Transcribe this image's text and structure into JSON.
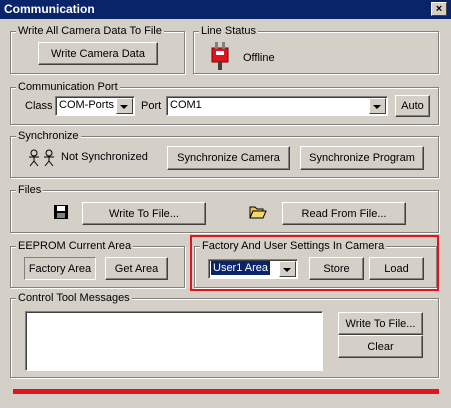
{
  "window": {
    "title": "Communication",
    "close_glyph": "×"
  },
  "write_all": {
    "legend": "Write All Camera Data To File",
    "button": "Write Camera Data"
  },
  "line_status": {
    "legend": "Line Status",
    "status": "Offline",
    "icon": "plug-icon"
  },
  "comm_port": {
    "legend": "Communication Port",
    "class_label": "Class",
    "class_value": "COM-Ports",
    "port_label": "Port",
    "port_value": "COM1",
    "auto_button": "Auto"
  },
  "synchronize": {
    "legend": "Synchronize",
    "status": "Not Synchronized",
    "sync_camera_button": "Synchronize Camera",
    "sync_program_button": "Synchronize Program"
  },
  "files": {
    "legend": "Files",
    "write_button": "Write To File...",
    "read_button": "Read From File..."
  },
  "eeprom": {
    "legend": "EEPROM Current Area",
    "value": "Factory Area",
    "get_button": "Get Area"
  },
  "factory_user": {
    "legend": "Factory And User Settings In Camera",
    "selected": "User1 Area",
    "store_button": "Store",
    "load_button": "Load"
  },
  "messages": {
    "legend": "Control Tool Messages",
    "write_button": "Write To File...",
    "clear_button": "Clear"
  },
  "colors": {
    "title_bar": "#0a246a",
    "highlight": "#e0141e",
    "dialog": "#d4d0c8"
  }
}
